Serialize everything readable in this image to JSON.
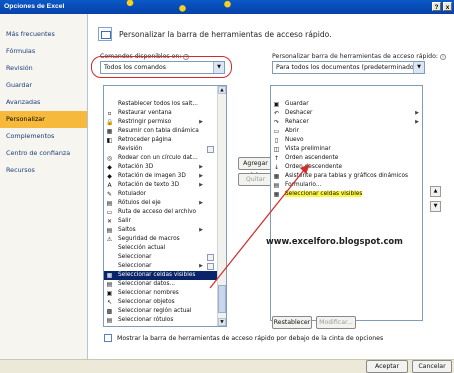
{
  "window": {
    "title": "Opciones de Excel",
    "help_glyph": "?",
    "close_glyph": "x"
  },
  "sidebar": {
    "items": [
      {
        "label": "Más frecuentes"
      },
      {
        "label": "Fórmulas"
      },
      {
        "label": "Revisión"
      },
      {
        "label": "Guardar"
      },
      {
        "label": "Avanzadas"
      },
      {
        "label": "Personalizar",
        "active": true
      },
      {
        "label": "Complementos"
      },
      {
        "label": "Centro de confianza"
      },
      {
        "label": "Recursos"
      }
    ]
  },
  "header": {
    "title": "Personalizar la barra de herramientas de acceso rápido."
  },
  "left_panel": {
    "label": "Comandos disponibles en:",
    "info": "i",
    "dropdown_value": "Todos los comandos",
    "items": [
      {
        "label": "Restablecer todos los salt...",
        "icon": ""
      },
      {
        "label": "Restaurar ventana",
        "icon": "▫"
      },
      {
        "label": "Restringir permiso",
        "icon": "🔒",
        "arrow": "▶"
      },
      {
        "label": "Resumir con tabla dinámica",
        "icon": "▦"
      },
      {
        "label": "Retroceder página",
        "icon": "◧"
      },
      {
        "label": "Revisión",
        "icon": "",
        "mini": true
      },
      {
        "label": "Rodear con un círculo dat...",
        "icon": "◎"
      },
      {
        "label": "Rotación 3D",
        "icon": "◆",
        "arrow": "▶"
      },
      {
        "label": "Rotación de imagen 3D",
        "icon": "◆",
        "arrow": "▶"
      },
      {
        "label": "Rotación de texto 3D",
        "icon": "A",
        "arrow": "▶"
      },
      {
        "label": "Rotulador",
        "icon": "✎"
      },
      {
        "label": "Rótulos del eje",
        "icon": "▤",
        "arrow": "▶"
      },
      {
        "label": "Ruta de acceso del archivo",
        "icon": "▭"
      },
      {
        "label": "Salir",
        "icon": "✕"
      },
      {
        "label": "Saltos",
        "icon": "▤",
        "arrow": "▶"
      },
      {
        "label": "Seguridad de macros",
        "icon": "⚠"
      },
      {
        "label": "Selección actual",
        "icon": ""
      },
      {
        "label": "Seleccionar",
        "icon": "",
        "mini": true
      },
      {
        "label": "Seleccionar",
        "icon": "",
        "arrow": "▶",
        "mini": true
      },
      {
        "label": "Seleccionar celdas visibles",
        "icon": "▦",
        "selected": true
      },
      {
        "label": "Seleccionar datos...",
        "icon": "▤"
      },
      {
        "label": "Seleccionar nombres",
        "icon": "▣"
      },
      {
        "label": "Seleccionar objetos",
        "icon": "↖"
      },
      {
        "label": "Seleccionar región actual",
        "icon": "▩"
      },
      {
        "label": "Seleccionar rótulos",
        "icon": "▤"
      }
    ]
  },
  "right_panel": {
    "label": "Personalizar barra de herramientas de acceso rápido:",
    "info": "i",
    "dropdown_value": "Para todos los documentos (predeterminado)",
    "items": [
      {
        "label": "Guardar",
        "icon": "▣"
      },
      {
        "label": "Deshacer",
        "icon": "↶",
        "arrow": "▶"
      },
      {
        "label": "Rehacer",
        "icon": "↷",
        "arrow": "▶"
      },
      {
        "label": "Abrir",
        "icon": "▭"
      },
      {
        "label": "Nuevo",
        "icon": "▯"
      },
      {
        "label": "Vista preliminar",
        "icon": "◫"
      },
      {
        "label": "Orden ascendente",
        "icon": "↑"
      },
      {
        "label": "Orden descendente",
        "icon": "↓"
      },
      {
        "label": "Asistente para tablas y gráficos dinámicos",
        "icon": "▦"
      },
      {
        "label": "Formulario...",
        "icon": "▤"
      },
      {
        "label": "Seleccionar celdas visibles",
        "icon": "▦",
        "highlight": true
      }
    ]
  },
  "buttons": {
    "add": "Agregar >>",
    "remove": "Quitar",
    "reset": "Restablecer",
    "modify": "Modificar...",
    "ok": "Aceptar",
    "cancel": "Cancelar",
    "move_up": "▲",
    "move_down": "▼"
  },
  "checkbox_label": "Mostrar la barra de herramientas de acceso rápido por debajo de la cinta de opciones",
  "watermark": "www.excelforo.blogspot.com",
  "colors": {
    "accent": "#f7b93c",
    "selection": "#0a246a",
    "highlight": "#fdf640",
    "annotation": "#d42a2a"
  }
}
